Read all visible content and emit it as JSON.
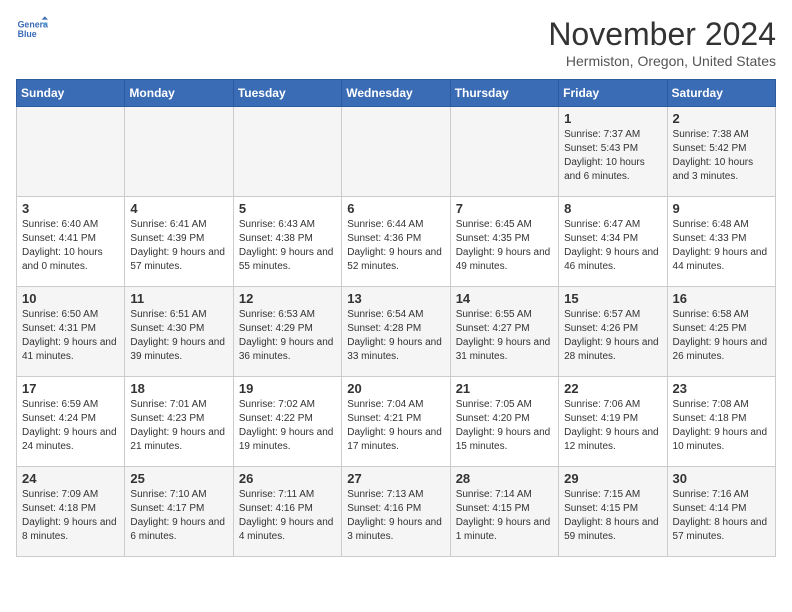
{
  "header": {
    "logo_line1": "General",
    "logo_line2": "Blue",
    "month_title": "November 2024",
    "location": "Hermiston, Oregon, United States"
  },
  "days_of_week": [
    "Sunday",
    "Monday",
    "Tuesday",
    "Wednesday",
    "Thursday",
    "Friday",
    "Saturday"
  ],
  "weeks": [
    [
      {
        "day": "",
        "info": ""
      },
      {
        "day": "",
        "info": ""
      },
      {
        "day": "",
        "info": ""
      },
      {
        "day": "",
        "info": ""
      },
      {
        "day": "",
        "info": ""
      },
      {
        "day": "1",
        "info": "Sunrise: 7:37 AM\nSunset: 5:43 PM\nDaylight: 10 hours and 6 minutes."
      },
      {
        "day": "2",
        "info": "Sunrise: 7:38 AM\nSunset: 5:42 PM\nDaylight: 10 hours and 3 minutes."
      }
    ],
    [
      {
        "day": "3",
        "info": "Sunrise: 6:40 AM\nSunset: 4:41 PM\nDaylight: 10 hours and 0 minutes."
      },
      {
        "day": "4",
        "info": "Sunrise: 6:41 AM\nSunset: 4:39 PM\nDaylight: 9 hours and 57 minutes."
      },
      {
        "day": "5",
        "info": "Sunrise: 6:43 AM\nSunset: 4:38 PM\nDaylight: 9 hours and 55 minutes."
      },
      {
        "day": "6",
        "info": "Sunrise: 6:44 AM\nSunset: 4:36 PM\nDaylight: 9 hours and 52 minutes."
      },
      {
        "day": "7",
        "info": "Sunrise: 6:45 AM\nSunset: 4:35 PM\nDaylight: 9 hours and 49 minutes."
      },
      {
        "day": "8",
        "info": "Sunrise: 6:47 AM\nSunset: 4:34 PM\nDaylight: 9 hours and 46 minutes."
      },
      {
        "day": "9",
        "info": "Sunrise: 6:48 AM\nSunset: 4:33 PM\nDaylight: 9 hours and 44 minutes."
      }
    ],
    [
      {
        "day": "10",
        "info": "Sunrise: 6:50 AM\nSunset: 4:31 PM\nDaylight: 9 hours and 41 minutes."
      },
      {
        "day": "11",
        "info": "Sunrise: 6:51 AM\nSunset: 4:30 PM\nDaylight: 9 hours and 39 minutes."
      },
      {
        "day": "12",
        "info": "Sunrise: 6:53 AM\nSunset: 4:29 PM\nDaylight: 9 hours and 36 minutes."
      },
      {
        "day": "13",
        "info": "Sunrise: 6:54 AM\nSunset: 4:28 PM\nDaylight: 9 hours and 33 minutes."
      },
      {
        "day": "14",
        "info": "Sunrise: 6:55 AM\nSunset: 4:27 PM\nDaylight: 9 hours and 31 minutes."
      },
      {
        "day": "15",
        "info": "Sunrise: 6:57 AM\nSunset: 4:26 PM\nDaylight: 9 hours and 28 minutes."
      },
      {
        "day": "16",
        "info": "Sunrise: 6:58 AM\nSunset: 4:25 PM\nDaylight: 9 hours and 26 minutes."
      }
    ],
    [
      {
        "day": "17",
        "info": "Sunrise: 6:59 AM\nSunset: 4:24 PM\nDaylight: 9 hours and 24 minutes."
      },
      {
        "day": "18",
        "info": "Sunrise: 7:01 AM\nSunset: 4:23 PM\nDaylight: 9 hours and 21 minutes."
      },
      {
        "day": "19",
        "info": "Sunrise: 7:02 AM\nSunset: 4:22 PM\nDaylight: 9 hours and 19 minutes."
      },
      {
        "day": "20",
        "info": "Sunrise: 7:04 AM\nSunset: 4:21 PM\nDaylight: 9 hours and 17 minutes."
      },
      {
        "day": "21",
        "info": "Sunrise: 7:05 AM\nSunset: 4:20 PM\nDaylight: 9 hours and 15 minutes."
      },
      {
        "day": "22",
        "info": "Sunrise: 7:06 AM\nSunset: 4:19 PM\nDaylight: 9 hours and 12 minutes."
      },
      {
        "day": "23",
        "info": "Sunrise: 7:08 AM\nSunset: 4:18 PM\nDaylight: 9 hours and 10 minutes."
      }
    ],
    [
      {
        "day": "24",
        "info": "Sunrise: 7:09 AM\nSunset: 4:18 PM\nDaylight: 9 hours and 8 minutes."
      },
      {
        "day": "25",
        "info": "Sunrise: 7:10 AM\nSunset: 4:17 PM\nDaylight: 9 hours and 6 minutes."
      },
      {
        "day": "26",
        "info": "Sunrise: 7:11 AM\nSunset: 4:16 PM\nDaylight: 9 hours and 4 minutes."
      },
      {
        "day": "27",
        "info": "Sunrise: 7:13 AM\nSunset: 4:16 PM\nDaylight: 9 hours and 3 minutes."
      },
      {
        "day": "28",
        "info": "Sunrise: 7:14 AM\nSunset: 4:15 PM\nDaylight: 9 hours and 1 minute."
      },
      {
        "day": "29",
        "info": "Sunrise: 7:15 AM\nSunset: 4:15 PM\nDaylight: 8 hours and 59 minutes."
      },
      {
        "day": "30",
        "info": "Sunrise: 7:16 AM\nSunset: 4:14 PM\nDaylight: 8 hours and 57 minutes."
      }
    ]
  ]
}
